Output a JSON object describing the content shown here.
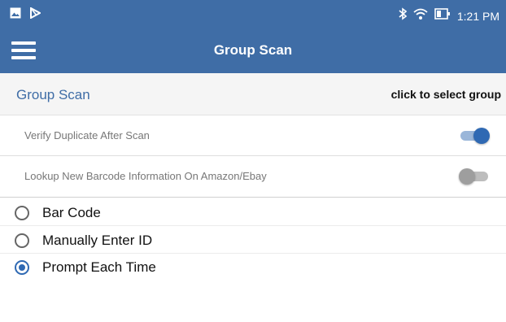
{
  "status_bar": {
    "time": "1:21 PM",
    "icons": [
      "image-icon",
      "play-store-icon",
      "bluetooth-icon",
      "wifi-icon",
      "battery-icon"
    ]
  },
  "app_bar": {
    "title": "Group Scan",
    "menu_icon": "hamburger-menu-icon"
  },
  "group_row": {
    "label": "Group Scan",
    "action": "click to select group"
  },
  "settings": [
    {
      "label": "Verify Duplicate After Scan",
      "enabled": true
    },
    {
      "label": "Lookup New Barcode Information On Amazon/Ebay",
      "enabled": false
    }
  ],
  "scan_options": {
    "selected": "Prompt Each Time",
    "items": [
      {
        "label": "Bar Code",
        "selected": false
      },
      {
        "label": "Manually Enter ID",
        "selected": false
      },
      {
        "label": "Prompt Each Time",
        "selected": true
      }
    ]
  },
  "colors": {
    "primary": "#3f6da6",
    "accent": "#2f69b3"
  }
}
